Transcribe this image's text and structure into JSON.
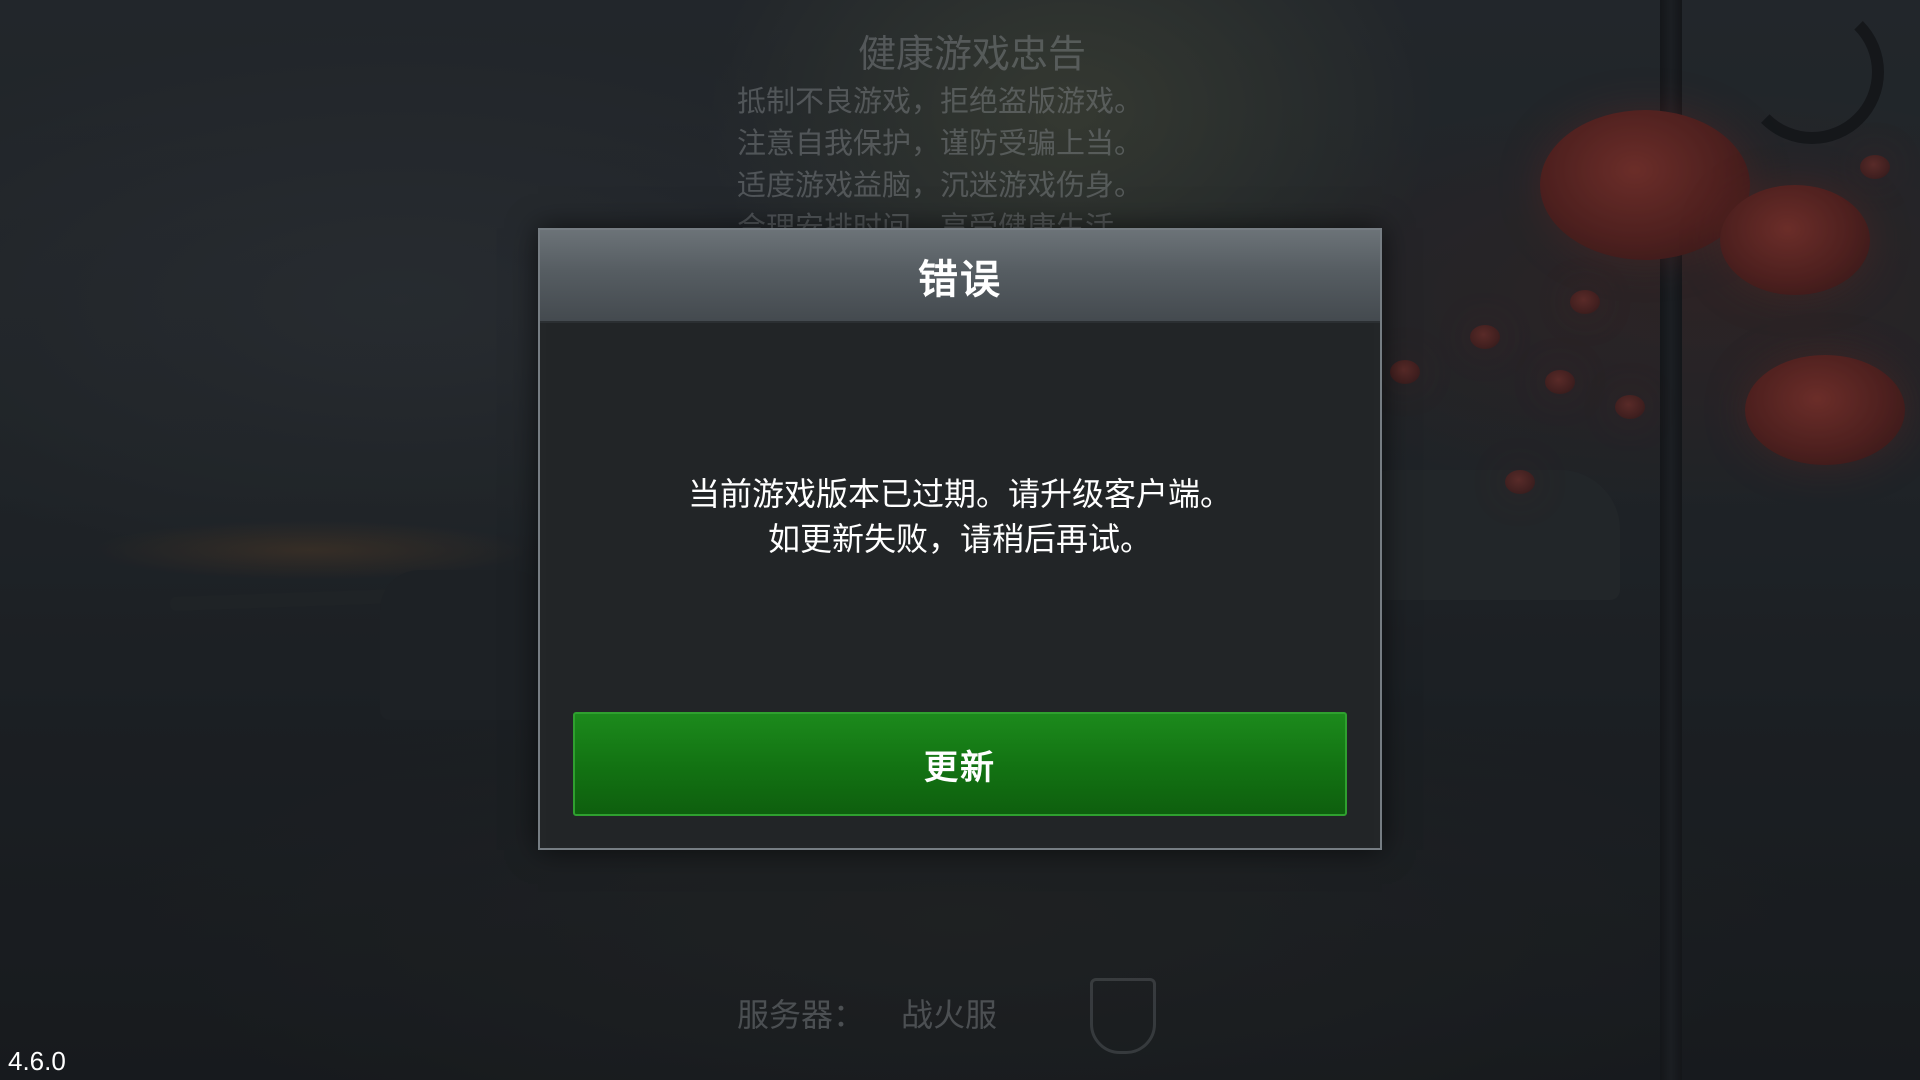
{
  "health_notice": {
    "title": "健康游戏忠告",
    "lines": [
      "抵制不良游戏，拒绝盗版游戏。",
      "注意自我保护，谨防受骗上当。",
      "适度游戏益脑，沉迷游戏伤身。",
      "合理安排时间，享受健康生活。"
    ]
  },
  "server": {
    "label": "服务器：",
    "name": "战火服"
  },
  "version": "4.6.0",
  "dialog": {
    "title": "错误",
    "message_line1": "当前游戏版本已过期。请升级客户端。",
    "message_line2": "如更新失败，请稍后再试。",
    "button_label": "更新"
  },
  "colors": {
    "button_green": "#137413",
    "header_gray": "#565d62",
    "dialog_bg": "#232628",
    "lantern_red": "#6d2520"
  },
  "icons": [
    "server-badge-icon"
  ]
}
